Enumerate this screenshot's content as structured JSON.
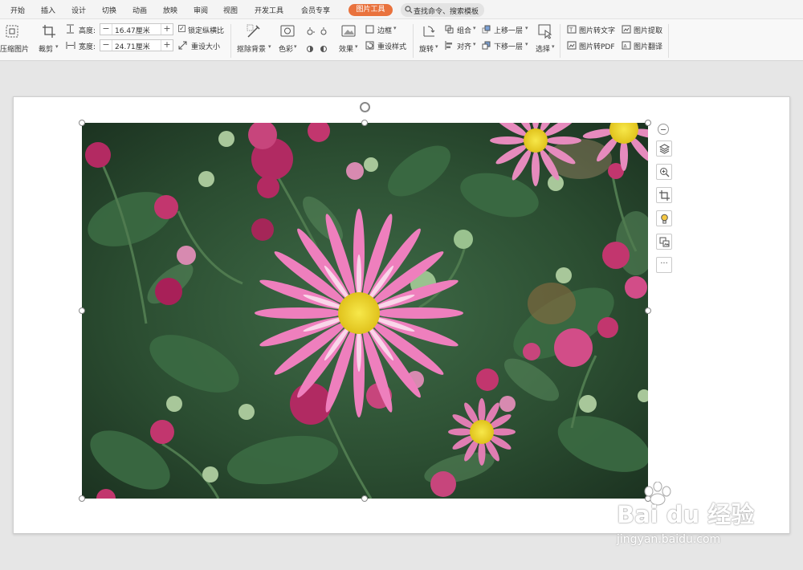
{
  "menu": {
    "items": [
      "开始",
      "插入",
      "设计",
      "切换",
      "动画",
      "放映",
      "审阅",
      "视图",
      "开发工具",
      "会员专享"
    ],
    "active_tab": "图片工具",
    "search_placeholder": "查找命令、搜索模板"
  },
  "ribbon": {
    "compress": "压缩图片",
    "crop": "裁剪",
    "height_label": "高度:",
    "height_value": "16.47厘米",
    "width_label": "宽度:",
    "width_value": "24.71厘米",
    "lock_ratio": "锁定纵横比",
    "resize": "重设大小",
    "remove_bg": "抠除背景",
    "color": "色彩",
    "effect": "效果",
    "border": "边框",
    "reset_style": "重设样式",
    "rotate": "旋转",
    "group": "组合",
    "align": "对齐",
    "bring_forward": "上移一层",
    "send_backward": "下移一层",
    "select": "选择",
    "to_text": "图片转文字",
    "extract": "图片提取",
    "to_pdf": "图片转PDF",
    "translate": "图片翻译"
  },
  "float_toolbar": {
    "more": "···"
  },
  "watermark": {
    "logo": "Bai du 经验",
    "url": "jingyan.baidu.com"
  },
  "colors": {
    "accent": "#e9723d",
    "slide_bg": "#ffffff",
    "workspace_bg": "#e6e6e6"
  }
}
